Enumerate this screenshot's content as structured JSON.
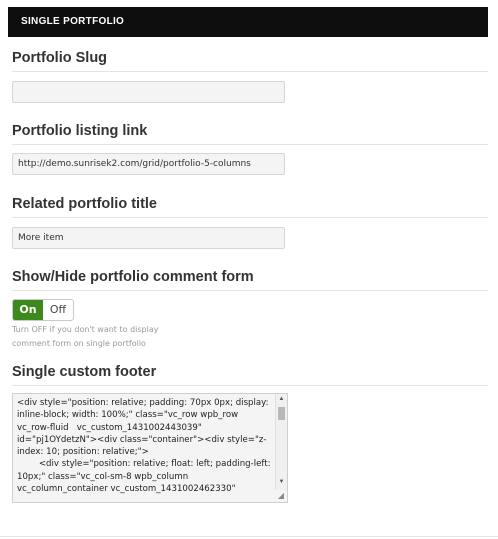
{
  "header": {
    "title": "SINGLE PORTFOLIO"
  },
  "fields": {
    "slug": {
      "label": "Portfolio Slug",
      "value": ""
    },
    "listing_link": {
      "label": "Portfolio listing link",
      "value": "http://demo.sunrisek2.com/grid/portfolio-5-columns"
    },
    "related_title": {
      "label": "Related portfolio title",
      "value": "More item"
    },
    "comment_form": {
      "label": "Show/Hide portfolio comment form",
      "on_label": "On",
      "off_label": "Off",
      "selected": "On",
      "hint": "Turn OFF if you don't want to display comment form on single portfolio"
    },
    "custom_footer": {
      "label": "Single custom footer",
      "value": "<div style=\"position: relative; padding: 70px 0px; display: inline-block; width: 100%;\" class=\"vc_row wpb_row vc_row-fluid   vc_custom_1431002443039\" id=\"pj1OYdetzN\"><div class=\"container\"><div style=\"z-index: 10; position: relative;\">\n        <div style=\"position: relative; float: left; padding-left: 10px;\" class=\"vc_col-sm-8 wpb_column vc_column_container vc_custom_1431002462330\""
    }
  },
  "icons": {
    "scroll_up": "scroll-up-arrow-icon",
    "scroll_down": "scroll-down-arrow-icon",
    "resize": "resize-grip-icon"
  }
}
